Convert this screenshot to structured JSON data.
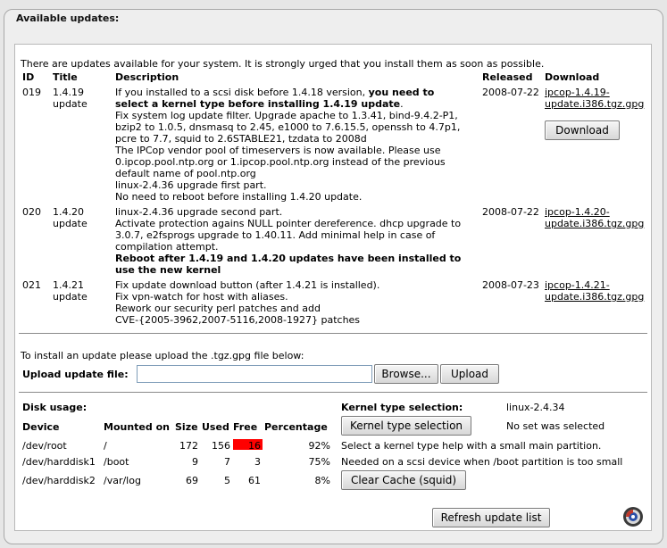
{
  "header": {
    "title": "Available updates:"
  },
  "intro": "There are updates available for your system. It is strongly urged that you install them as soon as possible.",
  "columns": {
    "id": "ID",
    "title": "Title",
    "description": "Description",
    "released": "Released",
    "download": "Download"
  },
  "updates": [
    {
      "id": "019",
      "title_line1": "1.4.19",
      "title_line2": "update",
      "desc": [
        "If you installed to a scsi disk before 1.4.18 version, ",
        "you need to",
        "select a kernel type before installing 1.4.19 update",
        ".",
        "Fix system log update filter. Upgrade apache to 1.3.41, bind-9.4.2-P1,",
        "bzip2 to 1.0.5, dnsmasq to 2.45, e1000 to 7.6.15.5, openssh to 4.7p1,",
        "pcre to 7.7, squid to 2.6STABLE21, tzdata to 2008d",
        "The IPCop vendor pool of timeservers is now available. Please use",
        "0.ipcop.pool.ntp.org or 1.ipcop.pool.ntp.org instead of the previous",
        "default name of pool.ntp.org",
        "linux-2.4.36 upgrade first part.",
        "No need to reboot before installing 1.4.20 update."
      ],
      "released": "2008-07-22",
      "link_line1": "ipcop-1.4.19-",
      "link_line2": "update.i386.tgz.gpg",
      "download_button": "Download"
    },
    {
      "id": "020",
      "title_line1": "1.4.20",
      "title_line2": "update",
      "desc": [
        "linux-2.4.36 upgrade second part.",
        "Activate protection agains NULL pointer dereference. dhcp upgrade to",
        "3.0.7, e2fsprogs upgrade to 1.40.11. Add minimal help in case of",
        "compilation attempt.",
        "Reboot after 1.4.19 and 1.4.20 updates have been installed to",
        "use the new kernel"
      ],
      "released": "2008-07-22",
      "link_line1": "ipcop-1.4.20-",
      "link_line2": "update.i386.tgz.gpg"
    },
    {
      "id": "021",
      "title_line1": "1.4.21",
      "title_line2": "update",
      "desc": [
        "Fix update download button (after 1.4.21 is installed).",
        "Fix vpn-watch for host with aliases.",
        "Rework our security perl patches and add",
        "CVE-{2005-3962,2007-5116,2008-1927} patches"
      ],
      "released": "2008-07-23",
      "link_line1": "ipcop-1.4.21-",
      "link_line2": "update.i386.tgz.gpg"
    }
  ],
  "upload": {
    "instruction": "To install an update please upload the .tgz.gpg file below:",
    "label": "Upload update file:",
    "value": "",
    "browse": "Browse...",
    "upload": "Upload"
  },
  "disk": {
    "title": "Disk usage:",
    "headers": {
      "device": "Device",
      "mounted": "Mounted on",
      "size": "Size",
      "used": "Used",
      "free": "Free",
      "percentage": "Percentage"
    },
    "rows": [
      {
        "device": "/dev/root",
        "mounted": "/",
        "size": "172",
        "used": "156",
        "free": "16",
        "percentage": "92%",
        "free_highlight": true
      },
      {
        "device": "/dev/harddisk1",
        "mounted": "/boot",
        "size": "9",
        "used": "7",
        "free": "3",
        "percentage": "75%"
      },
      {
        "device": "/dev/harddisk2",
        "mounted": "/var/log",
        "size": "69",
        "used": "5",
        "free": "61",
        "percentage": "8%"
      }
    ],
    "highlight_color": "#ff0000"
  },
  "kernel": {
    "title": "Kernel type selection:",
    "value": "linux-2.4.34",
    "button": "Kernel type selection",
    "status": "No set was selected",
    "help1": "Select a kernel type help with a small main partition.",
    "help2": "Needed on a scsi device when /boot partition is too small",
    "clear_cache": "Clear Cache (squid)"
  },
  "refresh": "Refresh update list",
  "icons": {
    "logo": "ipcop-logo-icon"
  }
}
